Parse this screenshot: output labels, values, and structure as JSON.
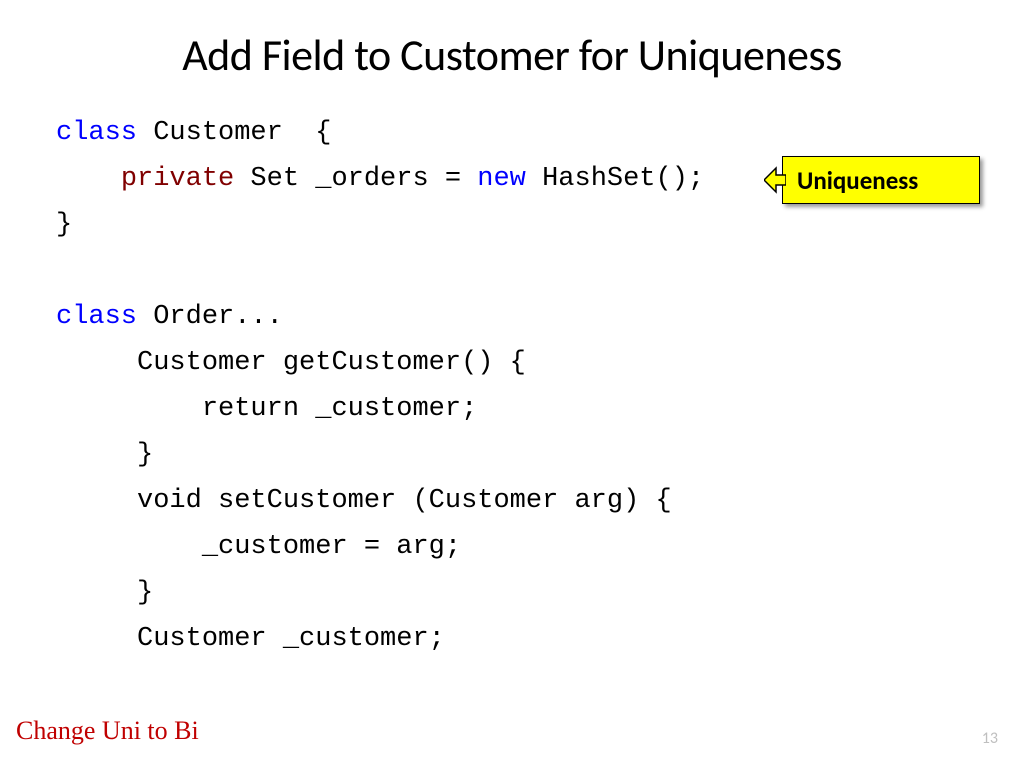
{
  "title": "Add Field to Customer for Uniqueness",
  "code": {
    "l1_class": "class",
    "l1_name": " Customer  {",
    "l2_indent": "    ",
    "l2_private": "private",
    "l2_set": " Set ",
    "l2_field": "_orders",
    "l2_eq": " = ",
    "l2_new": "new",
    "l2_hashset": " HashSet();",
    "l3": "}",
    "blank": "",
    "l5_class": "class",
    "l5_rest": " Order...",
    "l6": "     Customer getCustomer() {",
    "l7": "         return _customer;",
    "l8": "     }",
    "l9": "     void setCustomer (Customer arg) {",
    "l10": "         _customer = arg;",
    "l11": "     }",
    "l12": "     Customer _customer;"
  },
  "callout_label": "Uniqueness",
  "footer_left": "Change Uni to Bi",
  "page_number": "13"
}
